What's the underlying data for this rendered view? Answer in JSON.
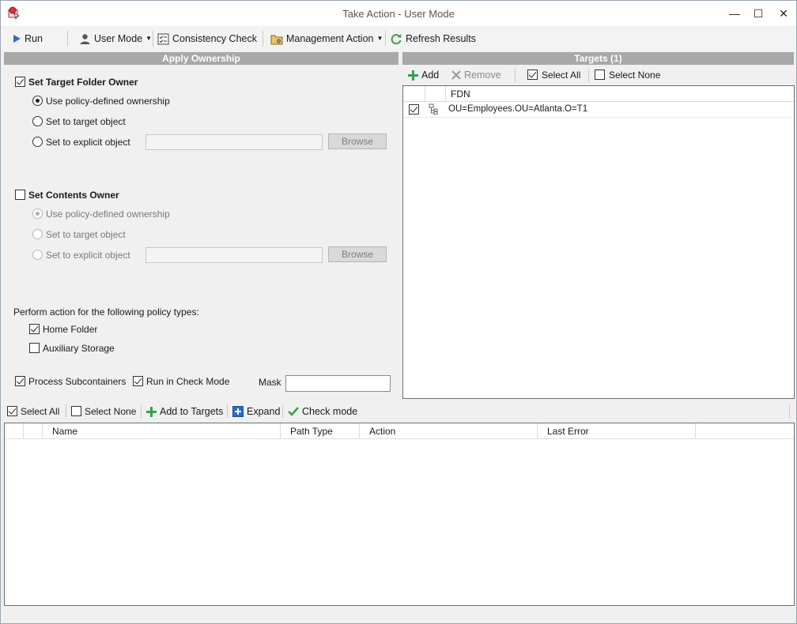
{
  "window": {
    "title": "Take Action - User Mode",
    "minimize_glyph": "—",
    "maximize_glyph": "☐",
    "close_glyph": "✕"
  },
  "toolbar": {
    "run": "Run",
    "user_mode": "User Mode",
    "consistency_check": "Consistency Check",
    "management_action": "Management Action",
    "refresh_results": "Refresh Results"
  },
  "apply_ownership": {
    "header": "Apply Ownership",
    "target_folder_owner": {
      "label": "Set Target Folder Owner",
      "checked": true,
      "options": [
        "Use policy-defined ownership",
        "Set to target object",
        "Set to explicit object"
      ],
      "selected_index": 0,
      "explicit_value": "",
      "browse": "Browse"
    },
    "contents_owner": {
      "label": "Set Contents Owner",
      "checked": false,
      "options": [
        "Use policy-defined ownership",
        "Set to target object",
        "Set to explicit object"
      ],
      "selected_index": 0,
      "explicit_value": "",
      "browse": "Browse"
    },
    "policy_types_label": "Perform action for the following policy types:",
    "policy_types": [
      {
        "label": "Home Folder",
        "checked": true
      },
      {
        "label": "Auxiliary Storage",
        "checked": false
      }
    ],
    "process_subcontainers": {
      "label": "Process Subcontainers",
      "checked": true
    },
    "run_check_mode": {
      "label": "Run in Check Mode",
      "checked": true
    },
    "mask_label": "Mask",
    "mask_value": ""
  },
  "targets": {
    "header": "Targets  (1)",
    "toolbar": {
      "add": "Add",
      "remove": "Remove",
      "select_all": "Select All",
      "select_none": "Select None"
    },
    "columns": [
      "FDN"
    ],
    "rows": [
      {
        "checked": true,
        "fdn": "OU=Employees.OU=Atlanta.O=T1"
      }
    ]
  },
  "results": {
    "toolbar": {
      "select_all": "Select All",
      "select_none": "Select None",
      "add_to_targets": "Add to Targets",
      "expand": "Expand",
      "check_mode": "Check mode"
    },
    "columns": [
      "Name",
      "Path Type",
      "Action",
      "Last Error"
    ]
  },
  "colors": {
    "panel_header": "#a8a8a8",
    "accent_green": "#3aa04a",
    "accent_blue": "#2b6cc4"
  }
}
